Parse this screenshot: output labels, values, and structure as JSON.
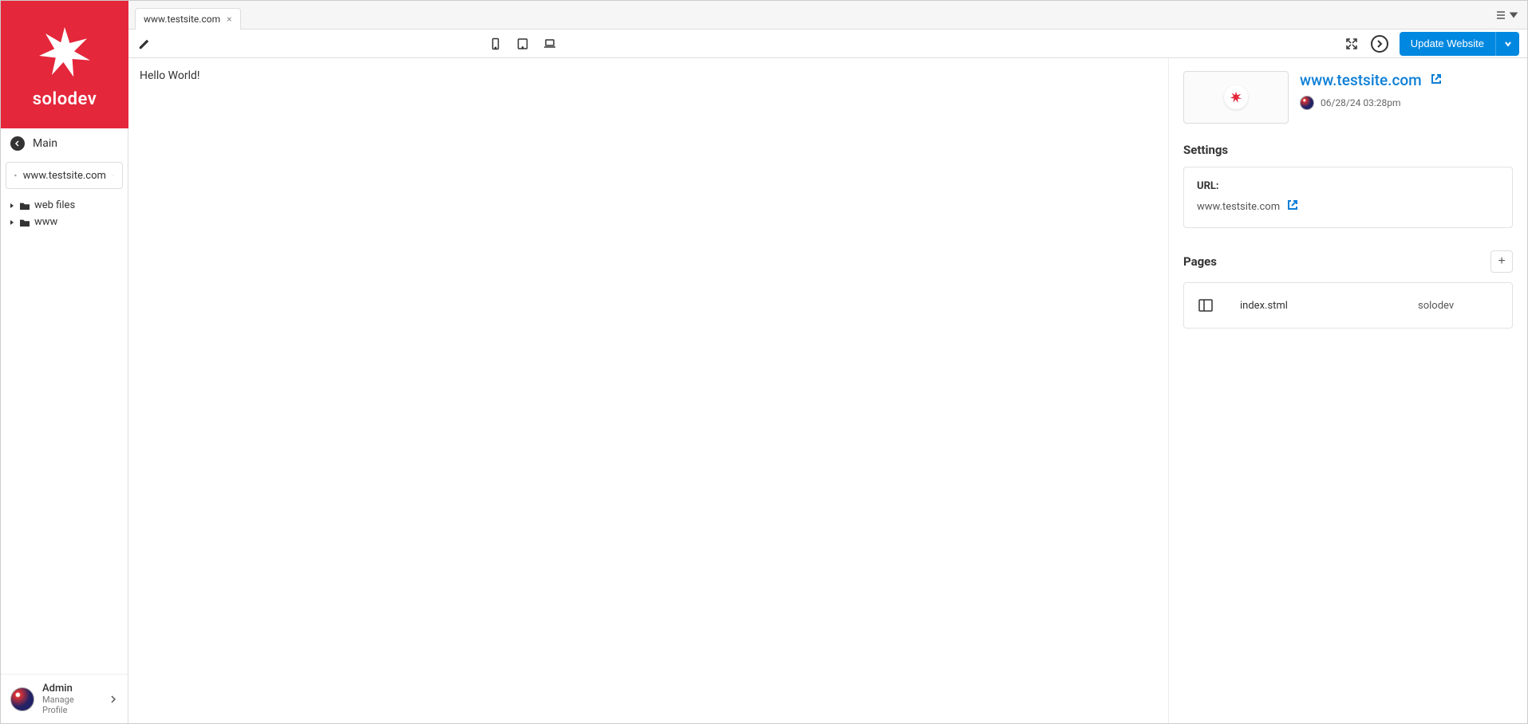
{
  "brand": "solodev",
  "sidebar": {
    "main_label": "Main",
    "site_selector": "www.testsite.com",
    "tree": [
      {
        "label": "web files"
      },
      {
        "label": "www"
      }
    ]
  },
  "profile": {
    "name": "Admin",
    "subtitle": "Manage Profile"
  },
  "tab": {
    "label": "www.testsite.com"
  },
  "toolbar": {
    "update_label": "Update Website"
  },
  "preview": {
    "content": "Hello World!"
  },
  "details": {
    "site_title": "www.testsite.com",
    "timestamp": "06/28/24 03:28pm",
    "settings_title": "Settings",
    "url_label": "URL:",
    "url_value": "www.testsite.com",
    "pages_title": "Pages",
    "pages": [
      {
        "name": "index.stml",
        "author": "solodev"
      }
    ]
  }
}
